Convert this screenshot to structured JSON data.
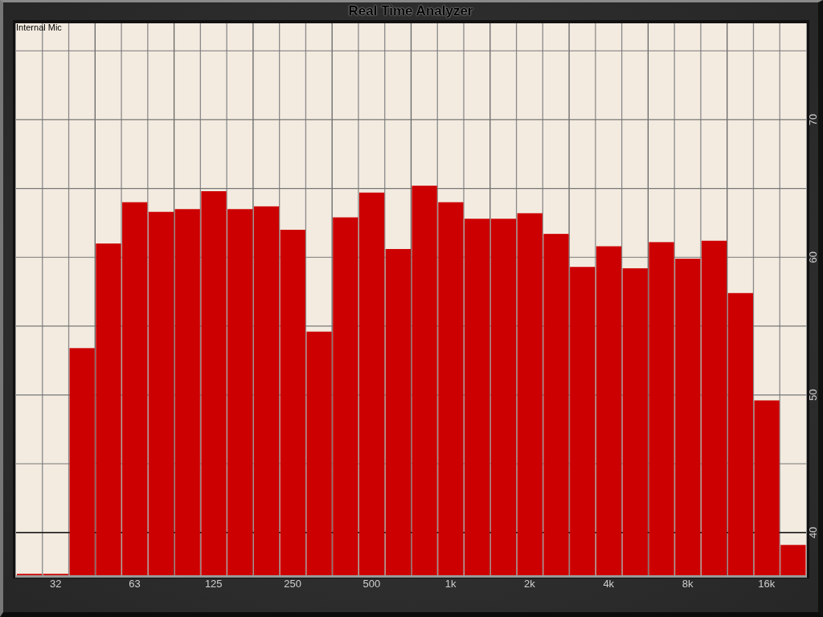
{
  "chart_data": {
    "type": "bar",
    "title": "Real Time Analyzer",
    "categories": [
      null,
      "32",
      null,
      null,
      "63",
      null,
      null,
      "125",
      null,
      null,
      "250",
      null,
      null,
      "500",
      null,
      null,
      "1k",
      null,
      null,
      "2k",
      null,
      null,
      "4k",
      null,
      null,
      "8k",
      null,
      null,
      "16k",
      null
    ],
    "series": [
      {
        "name": "Internal Mic",
        "color": "#cc0000",
        "values": [
          37.0,
          37.0,
          53.4,
          61.0,
          64.0,
          63.3,
          63.5,
          64.8,
          63.5,
          63.7,
          62.0,
          54.6,
          62.9,
          64.7,
          60.6,
          65.2,
          64.0,
          62.8,
          62.8,
          63.2,
          61.7,
          59.3,
          60.8,
          59.2,
          61.1,
          59.9,
          61.2,
          57.4,
          49.6,
          39.1
        ]
      }
    ],
    "ylim": [
      36.9,
      77
    ],
    "yticks": [
      40,
      50,
      60,
      70
    ],
    "grid": true,
    "ref_lines": [
      {
        "axis": "y",
        "value": 40,
        "color": "#000000"
      }
    ]
  }
}
